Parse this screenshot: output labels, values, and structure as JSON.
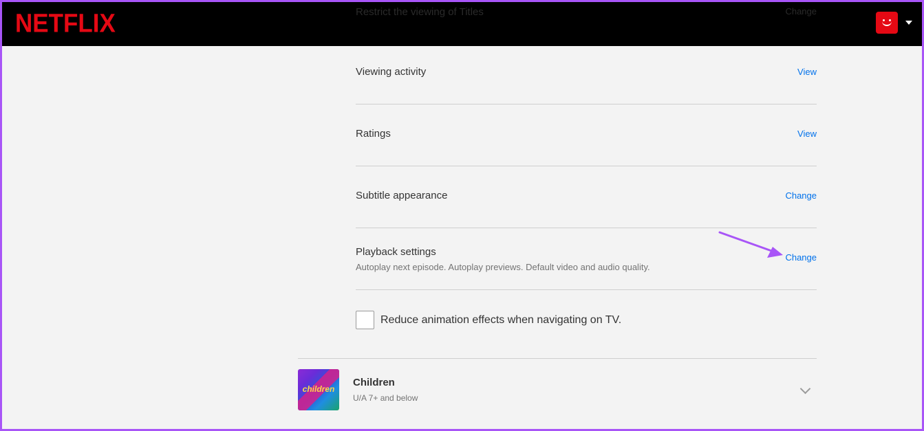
{
  "header": {
    "logo": "NETFLIX",
    "hidden_row_label": "Restrict the viewing of Titles",
    "hidden_row_link": "Change"
  },
  "settings": [
    {
      "label": "Viewing activity",
      "link": "View"
    },
    {
      "label": "Ratings",
      "link": "View"
    },
    {
      "label": "Subtitle appearance",
      "link": "Change"
    },
    {
      "label": "Playback settings",
      "description": "Autoplay next episode. Autoplay previews. Default video and audio quality.",
      "link": "Change"
    }
  ],
  "checkbox": {
    "label": "Reduce animation effects when navigating on TV.",
    "checked": false
  },
  "profile": {
    "name": "Children",
    "rating": "U/A 7+ and below",
    "image_text": "children"
  },
  "colors": {
    "accent": "#e50914",
    "link": "#0071eb",
    "annotation": "#a855f7"
  }
}
